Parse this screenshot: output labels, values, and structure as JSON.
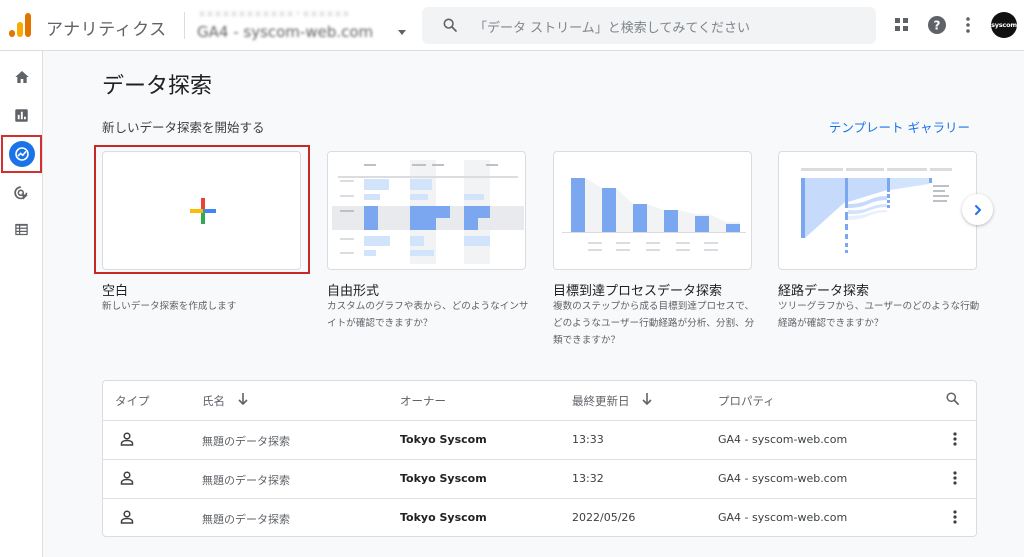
{
  "header": {
    "app_title": "アナリティクス",
    "account_line": "ｘｘｘｘｘｘｘｘｘｘｘｘ・ｘｘｘｘｘｘ",
    "property_name": "GA4 - syscom-web.com",
    "search_placeholder": "「データ ストリーム」と検索してみてください",
    "avatar_text": "syscom",
    "icons": [
      "analytics-logo",
      "search-icon",
      "apps-grid-icon",
      "help-icon",
      "more-vert-icon"
    ]
  },
  "rail": {
    "items": [
      {
        "name": "home-icon",
        "active": false
      },
      {
        "name": "reports-icon",
        "active": false
      },
      {
        "name": "explore-icon",
        "active": true
      },
      {
        "name": "advertising-icon",
        "active": false
      },
      {
        "name": "configure-icon",
        "active": false
      }
    ],
    "active_color": "#1a73e8",
    "highlight_color": "#d32f2f"
  },
  "main": {
    "title": "データ探索",
    "section_heading": "新しいデータ探索を開始する",
    "gallery_link": "テンプレート ギャラリー",
    "cards": [
      {
        "title": "空白",
        "description": "新しいデータ探索を作成します"
      },
      {
        "title": "自由形式",
        "description": "カスタムのグラフや表から、どのようなインサイトが確認できますか？"
      },
      {
        "title": "目標到達プロセスデータ探索",
        "description": "複数のステップから成る目標到達プロセスで、どのようなユーザー行動経路が分析、分割、分類できますか？"
      },
      {
        "title": "経路データ探索",
        "description": "ツリーグラフから、ユーザーのどのような行動経路が確認できますか？"
      }
    ]
  },
  "table": {
    "headers": {
      "type": "タイプ",
      "name": "氏名",
      "owner": "オーナー",
      "modified": "最終更新日",
      "property": "プロパティ"
    },
    "rows": [
      {
        "name": "無題のデータ探索",
        "owner": "Tokyo Syscom",
        "modified": "13:33",
        "property": "GA4 - syscom-web.com"
      },
      {
        "name": "無題のデータ探索",
        "owner": "Tokyo Syscom",
        "modified": "13:32",
        "property": "GA4 - syscom-web.com"
      },
      {
        "name": "無題のデータ探索",
        "owner": "Tokyo Syscom",
        "modified": "2022/05/26",
        "property": "GA4 - syscom-web.com"
      }
    ]
  }
}
